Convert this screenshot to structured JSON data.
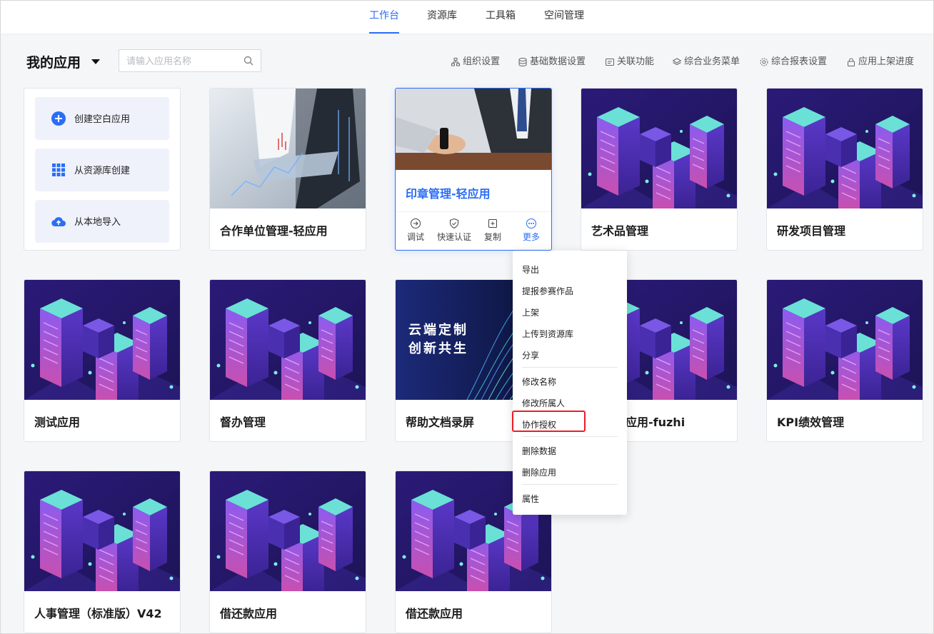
{
  "nav": {
    "tabs": [
      {
        "label": "工作台",
        "active": true
      },
      {
        "label": "资源库",
        "active": false
      },
      {
        "label": "工具箱",
        "active": false
      },
      {
        "label": "空间管理",
        "active": false
      }
    ]
  },
  "header": {
    "title": "我的应用",
    "search_placeholder": "请输入应用名称",
    "tools": [
      "组织设置",
      "基础数据设置",
      "关联功能",
      "综合业务菜单",
      "综合报表设置",
      "应用上架进度"
    ]
  },
  "create": {
    "blank": "创建空白应用",
    "from_library": "从资源库创建",
    "import_local": "从本地导入"
  },
  "apps": [
    "合作单位管理-轻应用",
    "印章管理-轻应用",
    "艺术品管理",
    "研发项目管理",
    "测试应用",
    "督办管理",
    "帮助文档录屏",
    "应用-fuzhi",
    "KPI绩效管理",
    "人事管理（标准版）V42",
    "借还款应用",
    "借还款应用"
  ],
  "card_actions": {
    "debug": "调试",
    "quick_auth": "快速认证",
    "copy": "复制",
    "more": "更多"
  },
  "banner": {
    "line1": "云端定制",
    "line2": "创新共生"
  },
  "menu": {
    "items": [
      "导出",
      "提报参赛作品",
      "上架",
      "上传到资源库",
      "分享",
      "修改名称",
      "修改所属人",
      "协作授权",
      "删除数据",
      "删除应用",
      "属性"
    ],
    "highlighted": "协作授权"
  },
  "colors": {
    "accent": "#2b6ef5",
    "highlight": "#ee1c25",
    "card_bg_dark": "#2a1f6b"
  }
}
